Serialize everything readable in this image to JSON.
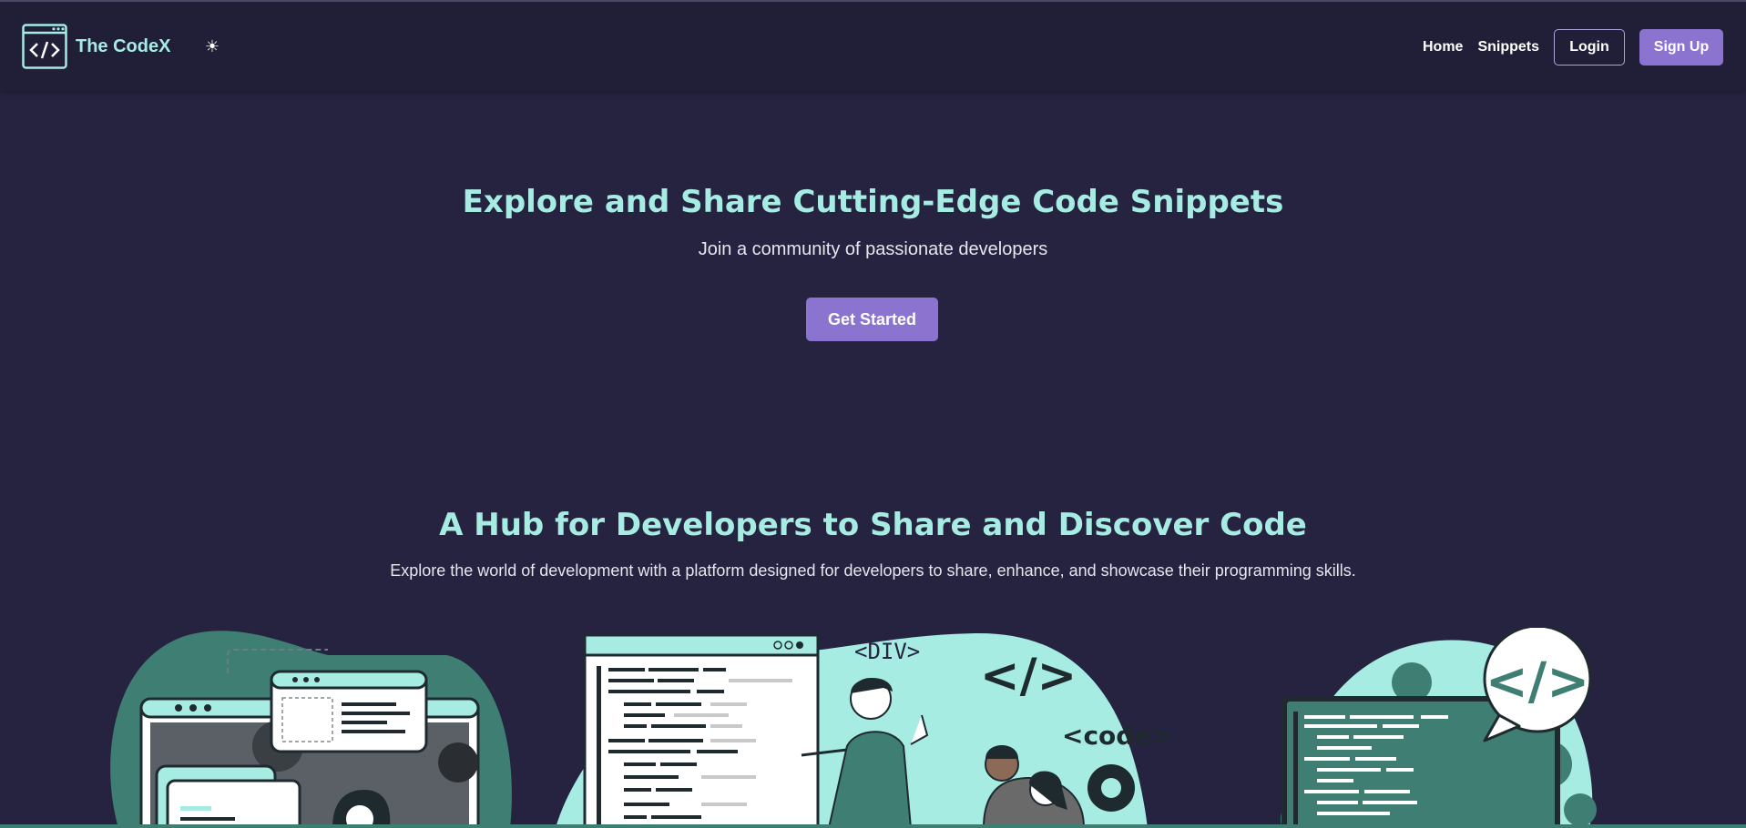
{
  "brand": {
    "name": "The CodeX",
    "logo_icon": "code-window-icon"
  },
  "theme_toggle": {
    "icon": "sun-icon",
    "glyph": "☀"
  },
  "nav": {
    "links": [
      {
        "label": "Home"
      },
      {
        "label": "Snippets"
      }
    ],
    "login_label": "Login",
    "signup_label": "Sign Up"
  },
  "hero": {
    "title": "Explore and Share Cutting-Edge Code Snippets",
    "subtitle": "Join a community of passionate developers",
    "cta_label": "Get Started"
  },
  "hub": {
    "title": "A Hub for Developers to Share and Discover Code",
    "subtitle": "Explore the world of development with a platform designed for developers to share, enhance, and showcase their programming skills."
  },
  "illustrations": {
    "tag_div": "<DIV>",
    "tag_code_symbol": "</>",
    "tag_code": "<code>",
    "bubble_symbol": "</>"
  },
  "colors": {
    "background": "#252340",
    "navbar": "#211f38",
    "accent_teal": "#a6ece3",
    "accent_purple": "#8a74cf",
    "dark_teal": "#3f7f73"
  }
}
